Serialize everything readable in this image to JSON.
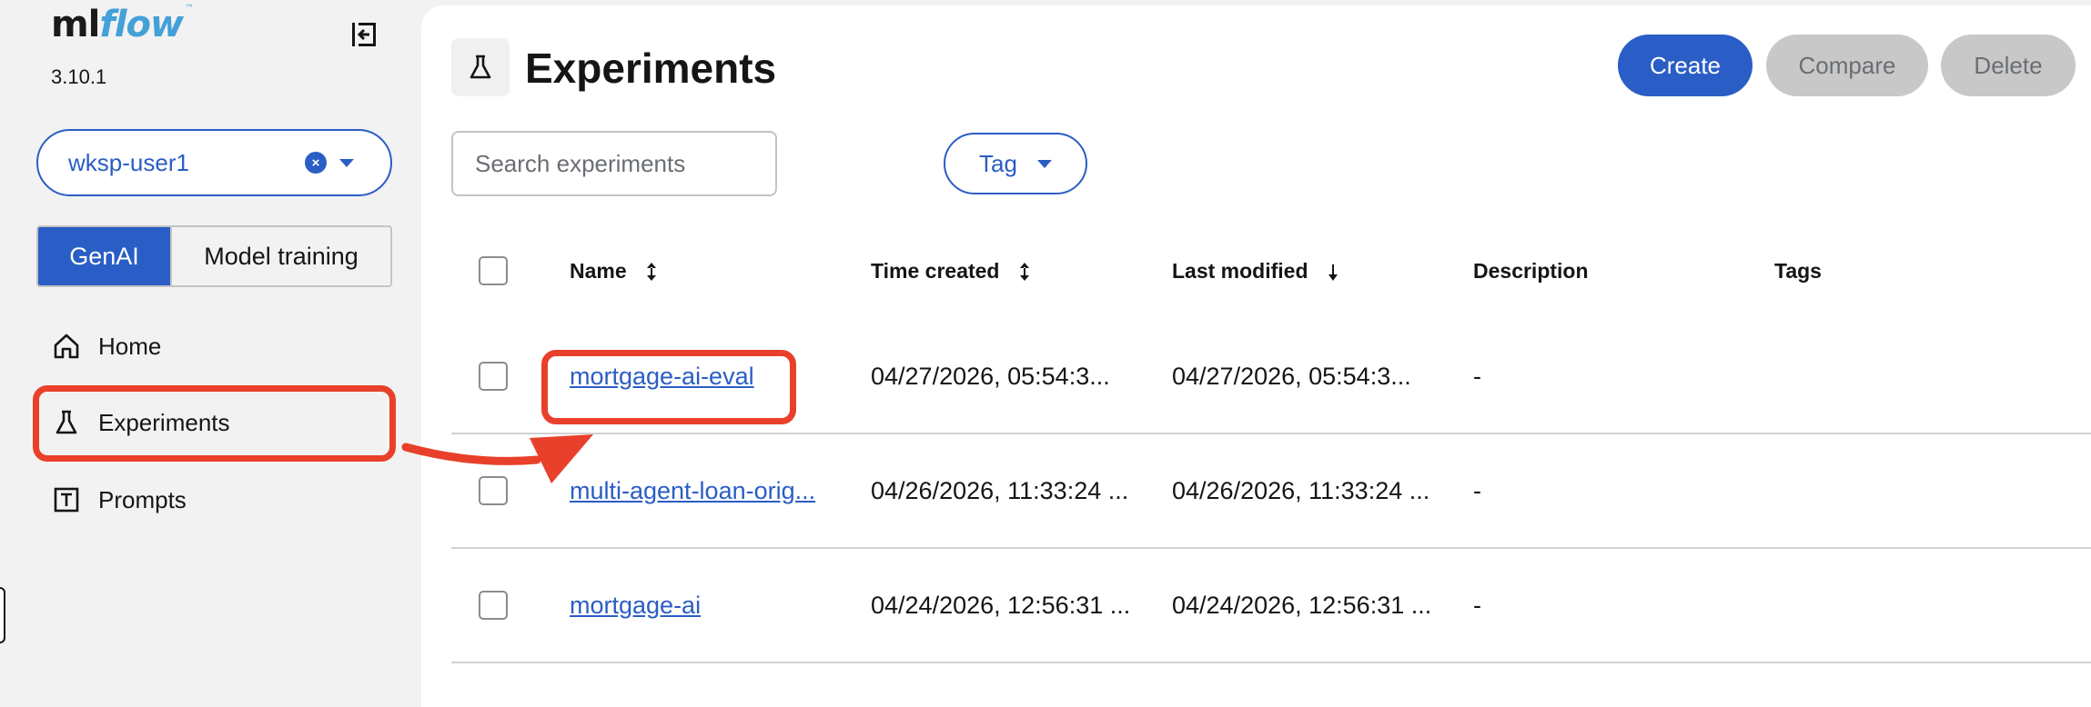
{
  "app": {
    "logo_ml": "ml",
    "logo_flow": "flow",
    "version": "3.10.1"
  },
  "sidebar": {
    "workspace": {
      "value": "wksp-user1"
    },
    "mode_toggle": {
      "genai": "GenAI",
      "model_training": "Model training"
    },
    "nav": [
      {
        "label": "Home",
        "icon": "home-icon"
      },
      {
        "label": "Experiments",
        "icon": "flask-icon"
      },
      {
        "label": "Prompts",
        "icon": "prompt-icon"
      }
    ]
  },
  "header": {
    "title": "Experiments",
    "buttons": {
      "create": "Create",
      "compare": "Compare",
      "delete": "Delete"
    }
  },
  "filters": {
    "search_placeholder": "Search experiments",
    "tag_label": "Tag"
  },
  "table": {
    "columns": {
      "name": "Name",
      "time_created": "Time created",
      "last_modified": "Last modified",
      "description": "Description",
      "tags": "Tags"
    },
    "rows": [
      {
        "name": "mortgage-ai-eval",
        "time_created": "04/27/2026, 05:54:3...",
        "last_modified": "04/27/2026, 05:54:3...",
        "description": "-"
      },
      {
        "name": "multi-agent-loan-orig...",
        "time_created": "04/26/2026, 11:33:24 ...",
        "last_modified": "04/26/2026, 11:33:24 ...",
        "description": "-"
      },
      {
        "name": "mortgage-ai",
        "time_created": "04/24/2026, 12:56:31 ...",
        "last_modified": "04/24/2026, 12:56:31 ...",
        "description": "-"
      }
    ]
  },
  "colors": {
    "accent": "#2a5dc5",
    "annotation": "#e8402a",
    "logo_flow": "#43a0d8"
  }
}
